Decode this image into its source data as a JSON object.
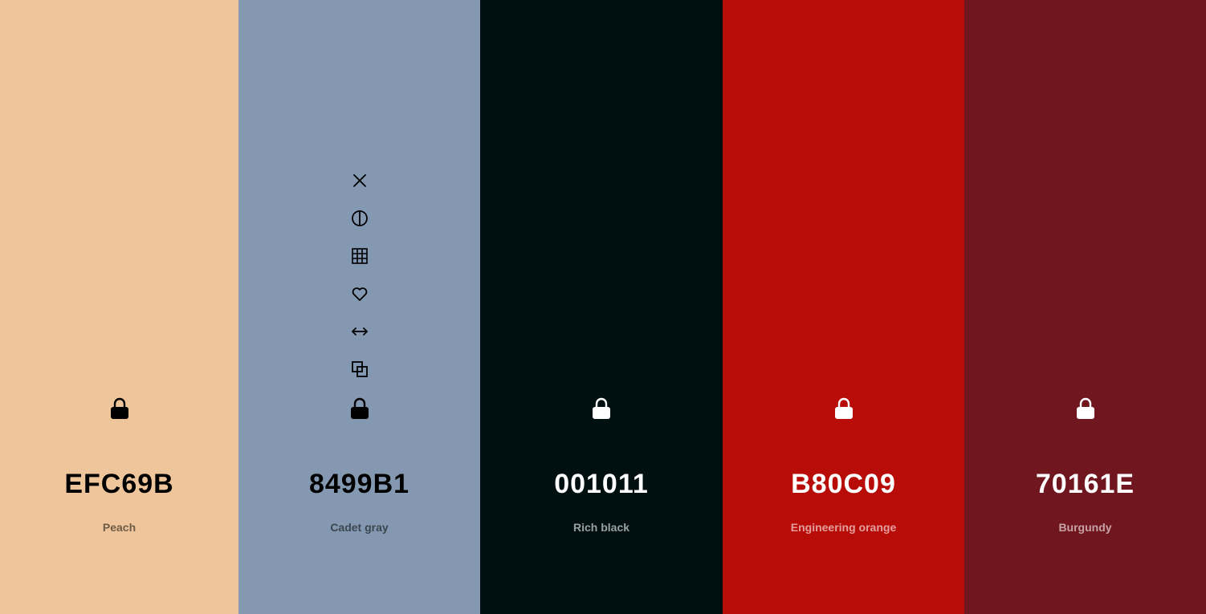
{
  "swatches": [
    {
      "hex": "EFC69B",
      "name": "Peach",
      "color": "#EFC69B"
    },
    {
      "hex": "8499B1",
      "name": "Cadet gray",
      "color": "#8499B1"
    },
    {
      "hex": "001011",
      "name": "Rich black",
      "color": "#001011"
    },
    {
      "hex": "B80C09",
      "name": "Engineering orange",
      "color": "#B80C09"
    },
    {
      "hex": "70161E",
      "name": "Burgundy",
      "color": "#70161E"
    }
  ],
  "hovered_swatch_tools": [
    "close-icon",
    "contrast-icon",
    "shades-grid-icon",
    "heart-icon",
    "drag-arrows-icon",
    "copy-icon"
  ],
  "lock_icon": "lock-icon"
}
